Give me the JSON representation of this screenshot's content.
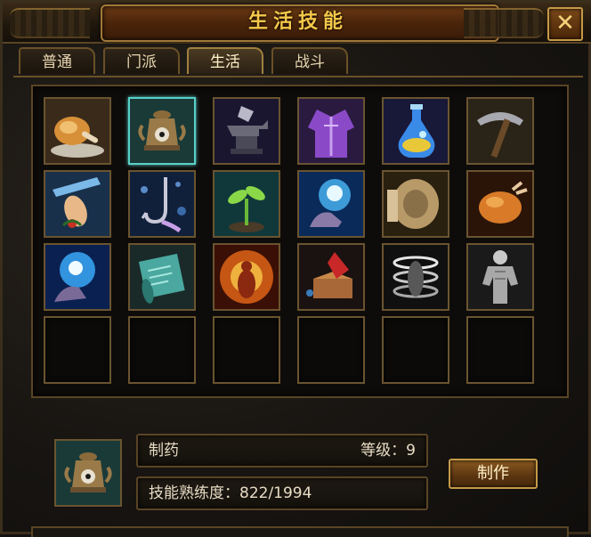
{
  "window": {
    "title": "生活技能",
    "close_label": "✕"
  },
  "tabs": [
    {
      "label": "普通",
      "active": false
    },
    {
      "label": "门派",
      "active": false
    },
    {
      "label": "生活",
      "active": true
    },
    {
      "label": "战斗",
      "active": false
    }
  ],
  "skills": [
    {
      "icon": "roast-chicken-icon"
    },
    {
      "icon": "alchemy-furnace-icon",
      "selected": true
    },
    {
      "icon": "anvil-icon"
    },
    {
      "icon": "robe-icon"
    },
    {
      "icon": "potion-flask-icon"
    },
    {
      "icon": "pickaxe-icon"
    },
    {
      "icon": "herb-gathering-icon"
    },
    {
      "icon": "fishing-hook-icon"
    },
    {
      "icon": "sprout-icon"
    },
    {
      "icon": "blue-magic-hand-icon"
    },
    {
      "icon": "stone-mill-icon"
    },
    {
      "icon": "roast-bird-icon"
    },
    {
      "icon": "blue-energy-hand-icon"
    },
    {
      "icon": "scroll-icon"
    },
    {
      "icon": "fire-meditation-icon"
    },
    {
      "icon": "book-crafting-icon"
    },
    {
      "icon": "white-spiral-icon"
    },
    {
      "icon": "muscle-body-icon"
    },
    {
      "icon": "empty-slot"
    },
    {
      "icon": "empty-slot"
    },
    {
      "icon": "empty-slot"
    },
    {
      "icon": "empty-slot"
    },
    {
      "icon": "empty-slot"
    },
    {
      "icon": "empty-slot"
    }
  ],
  "detail": {
    "icon": "alchemy-furnace-icon",
    "name": "制药",
    "level_text": "等级：9",
    "proficiency_text": "技能熟练度：822/1994",
    "make_button": "制作"
  }
}
